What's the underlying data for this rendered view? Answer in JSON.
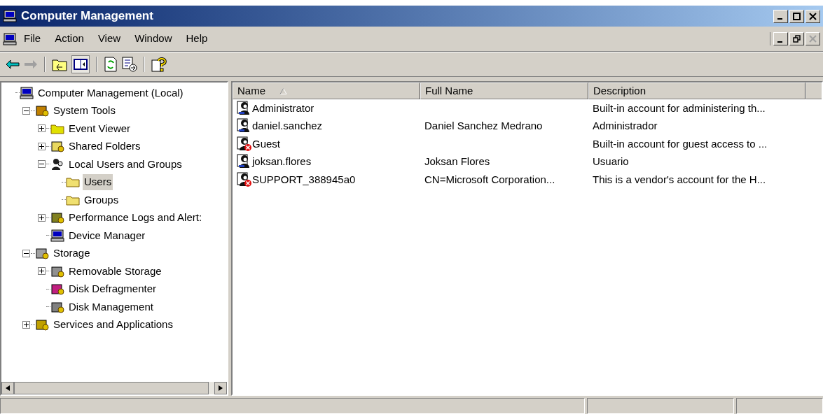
{
  "window": {
    "title": "Computer Management"
  },
  "menu": [
    "File",
    "Action",
    "View",
    "Window",
    "Help"
  ],
  "tree": [
    {
      "label": "Computer Management (Local)",
      "selected": false,
      "children": [
        {
          "label": "System Tools",
          "expanded": true,
          "selected": false,
          "children": [
            {
              "label": "Event Viewer",
              "expanded": false,
              "selected": false
            },
            {
              "label": "Shared Folders",
              "expanded": false,
              "selected": false
            },
            {
              "label": "Local Users and Groups",
              "expanded": true,
              "selected": false,
              "children": [
                {
                  "label": "Users",
                  "selected": true
                },
                {
                  "label": "Groups",
                  "selected": false
                }
              ]
            },
            {
              "label": "Performance Logs and Alert:",
              "expanded": false,
              "selected": false
            },
            {
              "label": "Device Manager",
              "selected": false
            }
          ]
        },
        {
          "label": "Storage",
          "expanded": true,
          "selected": false,
          "children": [
            {
              "label": "Removable Storage",
              "expanded": false,
              "selected": false
            },
            {
              "label": "Disk Defragmenter",
              "selected": false
            },
            {
              "label": "Disk Management",
              "selected": false
            }
          ]
        },
        {
          "label": "Services and Applications",
          "expanded": false,
          "selected": false
        }
      ]
    }
  ],
  "table": {
    "columns": [
      "Name",
      "Full Name",
      "Description"
    ],
    "rows": [
      {
        "name": "Administrator",
        "full_name": "",
        "description": "Built-in account for administering th...",
        "disabled": false
      },
      {
        "name": "daniel.sanchez",
        "full_name": "Daniel Sanchez Medrano",
        "description": "Administrador",
        "disabled": false
      },
      {
        "name": "Guest",
        "full_name": "",
        "description": "Built-in account for guest access to ...",
        "disabled": true
      },
      {
        "name": "joksan.flores",
        "full_name": "Joksan Flores",
        "description": "Usuario",
        "disabled": false
      },
      {
        "name": "SUPPORT_388945a0",
        "full_name": "CN=Microsoft Corporation...",
        "description": "This is a vendor's account for the H...",
        "disabled": true
      }
    ]
  }
}
